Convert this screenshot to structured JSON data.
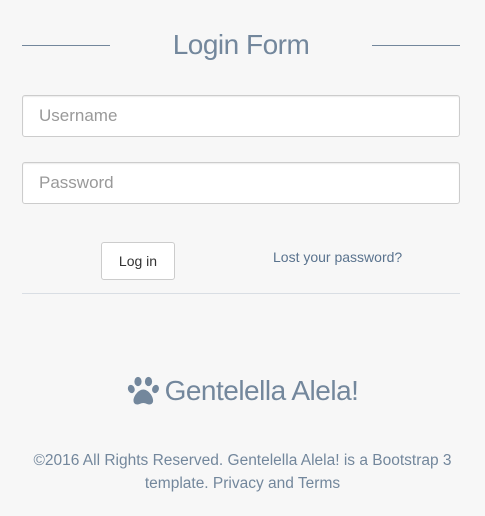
{
  "header": {
    "title": "Login Form"
  },
  "form": {
    "username_placeholder": "Username",
    "username_value": "",
    "password_placeholder": "Password",
    "password_value": "",
    "login_label": "Log in",
    "lost_password_label": "Lost your password?"
  },
  "brand": {
    "icon": "paw-icon",
    "name": "Gentelella Alela!"
  },
  "footer": {
    "text": "©2016 All Rights Reserved. Gentelella Alela! is a Bootstrap 3 template. Privacy and Terms"
  },
  "colors": {
    "background": "#F7F7F7",
    "text_muted": "#73879C",
    "link": "#5A738E",
    "border": "#CCCCCC"
  }
}
